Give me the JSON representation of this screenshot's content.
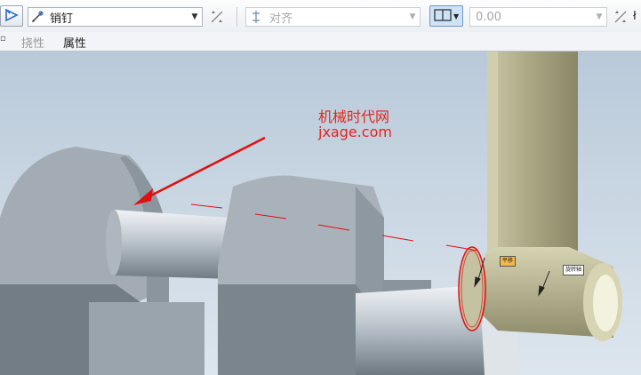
{
  "toolbar": {
    "constraint_type": "销钉",
    "constraint_sub": "对齐",
    "offset_value": "0.00",
    "clipped_label": "ł",
    "colors": {
      "accent_blue": "#2a6fc4",
      "toggle_active": "#cfe3f7"
    }
  },
  "tabs": [
    {
      "label": "▫"
    },
    {
      "label": "挠性"
    },
    {
      "label": "属性"
    }
  ],
  "watermark": {
    "line1": "机械时代网",
    "line2": "jxage.com",
    "color": "#e8231c"
  },
  "model_tags": {
    "left": "平移",
    "right": "旋转轴"
  },
  "icons": [
    "connection-icon",
    "pin-icon",
    "flip-icon",
    "align-icon",
    "plane-toggle-icon",
    "orient-flip-icon"
  ]
}
